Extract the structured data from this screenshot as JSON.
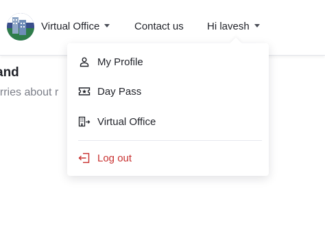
{
  "nav": {
    "virtual_office": "Virtual Office",
    "contact": "Contact us",
    "greeting": "Hi lavesh"
  },
  "background": {
    "heading": "and",
    "subtext": "orries about r"
  },
  "menu": {
    "items": [
      {
        "label": "My Profile",
        "icon": "user-icon"
      },
      {
        "label": "Day Pass",
        "icon": "ticket-icon"
      },
      {
        "label": "Virtual Office",
        "icon": "building-icon"
      }
    ],
    "logout": {
      "label": "Log out",
      "icon": "logout-icon"
    }
  },
  "colors": {
    "text": "#1f2128",
    "logout": "#c8302f",
    "logo_circle": "#3a4f8c"
  }
}
